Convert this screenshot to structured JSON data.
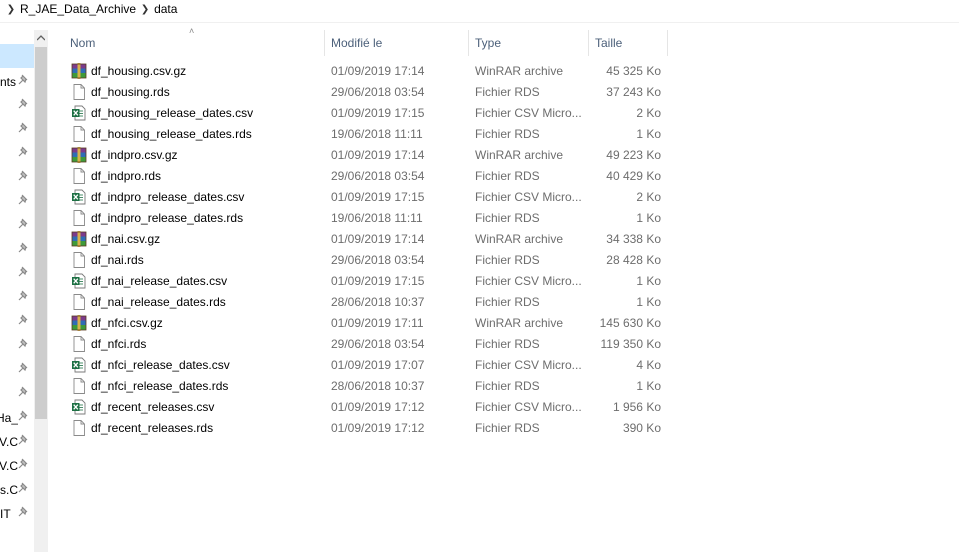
{
  "breadcrumb": {
    "items": [
      "R_JAE_Data_Archive",
      "data"
    ]
  },
  "nav": {
    "partial_labels": [
      "nts",
      "",
      "",
      "",
      "",
      "",
      "",
      "",
      "",
      "",
      "",
      "",
      "",
      "",
      "_Ha",
      "V.C",
      "V.C",
      "s.C",
      "IT"
    ]
  },
  "columns": {
    "name": "Nom",
    "date": "Modifié le",
    "type": "Type",
    "size": "Taille"
  },
  "files": [
    {
      "name": "df_housing.csv.gz",
      "date": "01/09/2019 17:14",
      "type": "WinRAR archive",
      "size": "45 325 Ko",
      "icon": "winrar-archive-icon"
    },
    {
      "name": "df_housing.rds",
      "date": "29/06/2018 03:54",
      "type": "Fichier RDS",
      "size": "37 243 Ko",
      "icon": "file-icon"
    },
    {
      "name": "df_housing_release_dates.csv",
      "date": "01/09/2019 17:15",
      "type": "Fichier CSV Micro...",
      "size": "2 Ko",
      "icon": "excel-csv-icon"
    },
    {
      "name": "df_housing_release_dates.rds",
      "date": "19/06/2018 11:11",
      "type": "Fichier RDS",
      "size": "1 Ko",
      "icon": "file-icon"
    },
    {
      "name": "df_indpro.csv.gz",
      "date": "01/09/2019 17:14",
      "type": "WinRAR archive",
      "size": "49 223 Ko",
      "icon": "winrar-archive-icon"
    },
    {
      "name": "df_indpro.rds",
      "date": "29/06/2018 03:54",
      "type": "Fichier RDS",
      "size": "40 429 Ko",
      "icon": "file-icon"
    },
    {
      "name": "df_indpro_release_dates.csv",
      "date": "01/09/2019 17:15",
      "type": "Fichier CSV Micro...",
      "size": "2 Ko",
      "icon": "excel-csv-icon"
    },
    {
      "name": "df_indpro_release_dates.rds",
      "date": "19/06/2018 11:11",
      "type": "Fichier RDS",
      "size": "1 Ko",
      "icon": "file-icon"
    },
    {
      "name": "df_nai.csv.gz",
      "date": "01/09/2019 17:14",
      "type": "WinRAR archive",
      "size": "34 338 Ko",
      "icon": "winrar-archive-icon"
    },
    {
      "name": "df_nai.rds",
      "date": "29/06/2018 03:54",
      "type": "Fichier RDS",
      "size": "28 428 Ko",
      "icon": "file-icon"
    },
    {
      "name": "df_nai_release_dates.csv",
      "date": "01/09/2019 17:15",
      "type": "Fichier CSV Micro...",
      "size": "1 Ko",
      "icon": "excel-csv-icon"
    },
    {
      "name": "df_nai_release_dates.rds",
      "date": "28/06/2018 10:37",
      "type": "Fichier RDS",
      "size": "1 Ko",
      "icon": "file-icon"
    },
    {
      "name": "df_nfci.csv.gz",
      "date": "01/09/2019 17:11",
      "type": "WinRAR archive",
      "size": "145 630 Ko",
      "icon": "winrar-archive-icon"
    },
    {
      "name": "df_nfci.rds",
      "date": "29/06/2018 03:54",
      "type": "Fichier RDS",
      "size": "119 350 Ko",
      "icon": "file-icon"
    },
    {
      "name": "df_nfci_release_dates.csv",
      "date": "01/09/2019 17:07",
      "type": "Fichier CSV Micro...",
      "size": "4 Ko",
      "icon": "excel-csv-icon"
    },
    {
      "name": "df_nfci_release_dates.rds",
      "date": "28/06/2018 10:37",
      "type": "Fichier RDS",
      "size": "1 Ko",
      "icon": "file-icon"
    },
    {
      "name": "df_recent_releases.csv",
      "date": "01/09/2019 17:12",
      "type": "Fichier CSV Micro...",
      "size": "1 956 Ko",
      "icon": "excel-csv-icon"
    },
    {
      "name": "df_recent_releases.rds",
      "date": "01/09/2019 17:12",
      "type": "Fichier RDS",
      "size": "390 Ko",
      "icon": "file-icon"
    }
  ],
  "colors": {
    "header_text": "#4c607a",
    "secondary_text": "#6d6d6d",
    "selection": "#cce8ff",
    "excel_green": "#1d7044",
    "winrar_purple": "#7b3b8c"
  }
}
